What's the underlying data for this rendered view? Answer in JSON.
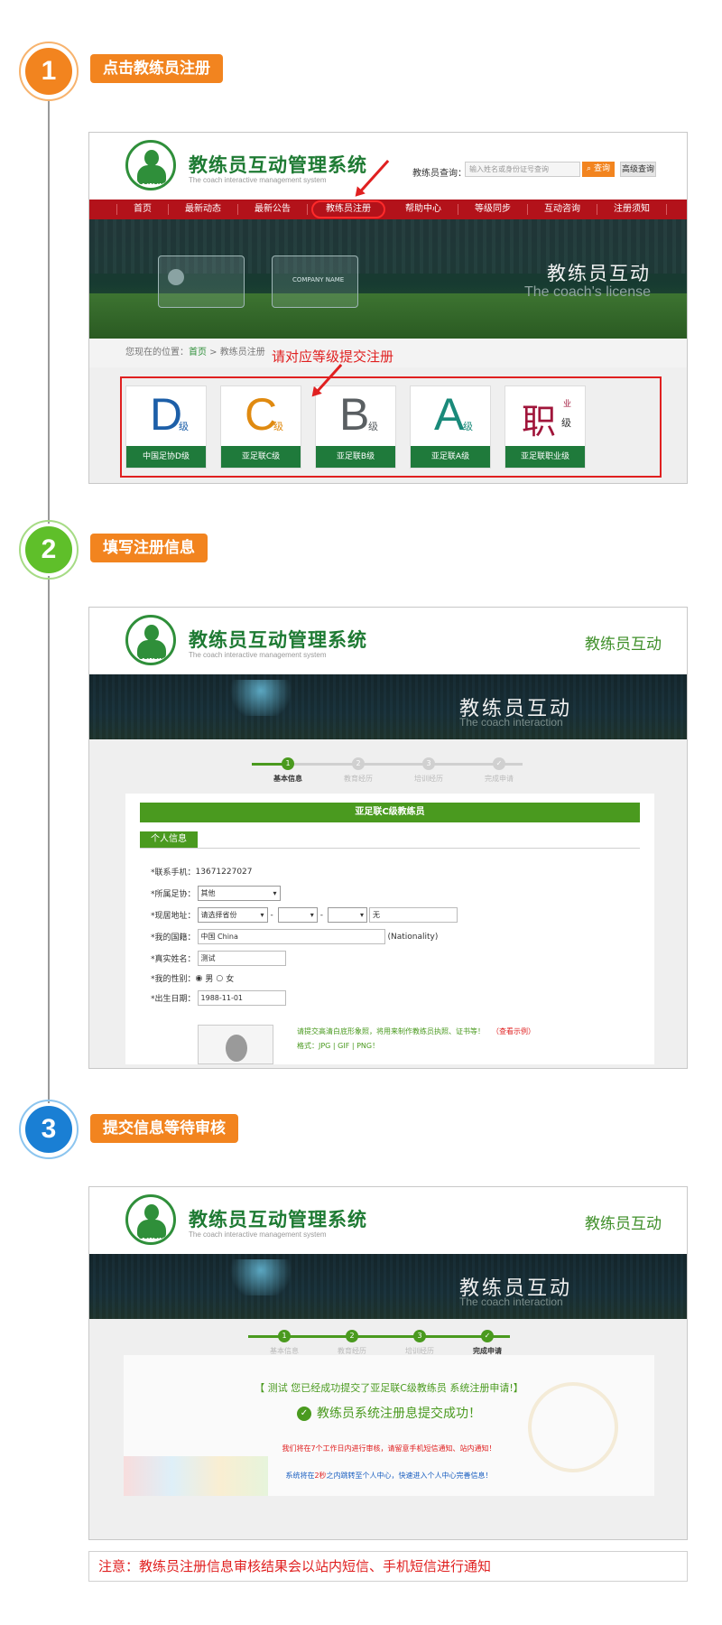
{
  "steps": [
    {
      "number": "1",
      "label": "点击教练员注册",
      "color": "#f2841f"
    },
    {
      "number": "2",
      "label": "填写注册信息",
      "color": "#5fbf2a"
    },
    {
      "number": "3",
      "label": "提交信息等待审核",
      "color": "#1a7fd4"
    }
  ],
  "site": {
    "title": "教练员互动管理系统",
    "subtitle": "The coach interactive management system",
    "logo_text": "COACH",
    "right_brand": "教练员互动"
  },
  "panel1": {
    "search_label": "教练员查询：",
    "search_placeholder": "输入姓名或身份证号查询",
    "search_button": "查询",
    "advanced_button": "高级查询",
    "nav": [
      "首页",
      "最新动态",
      "最新公告",
      "教练员注册",
      "帮助中心",
      "等级同步",
      "互动咨询",
      "注册须知"
    ],
    "card_label": "COMPANY NAME",
    "banner_cn": "教练员互动",
    "banner_en": "The coach's license",
    "breadcrumb_prefix": "您现在的位置：",
    "breadcrumb_home": "首页",
    "breadcrumb_sep": " > ",
    "breadcrumb_current": "教练员注册",
    "red_note": "请对应等级提交注册",
    "levels": [
      {
        "letter": "D",
        "suffix": "级",
        "label": "中国足协D级",
        "color": "#1d5fa8"
      },
      {
        "letter": "C",
        "suffix": "级",
        "label": "亚足联C级",
        "color": "#e08a10"
      },
      {
        "letter": "B",
        "suffix": "级",
        "label": "亚足联B级",
        "color": "#5a5f62"
      },
      {
        "letter": "A",
        "suffix": "级",
        "label": "亚足联A级",
        "color": "#1a8a7a"
      },
      {
        "letter": "职",
        "suffix": "级",
        "sup": "业",
        "label": "亚足联职业级",
        "color": "#a0153a"
      }
    ]
  },
  "panel2": {
    "banner_cn": "教练员互动",
    "banner_en": "The coach interaction",
    "stepper": [
      "基本信息",
      "教育经历",
      "培训经历",
      "完成申请"
    ],
    "form_header": "亚足联C级教练员",
    "tab": "个人信息",
    "fields": {
      "phone_label": "*联系手机：",
      "phone_value": "13671227027",
      "area_label": "*所属足协：",
      "area_value": "其他",
      "addr_label": "*现居地址：",
      "addr_province": "请选择省份",
      "addr_dash": "-",
      "addr_value": "无",
      "nation_label": "*我的国籍：",
      "nation_value": "中国 China",
      "nation_hint": "(Nationality)",
      "name_label": "*真实姓名：",
      "name_value": "测试",
      "gender_label": "*我的性别：",
      "gender_male": "男",
      "gender_female": "女",
      "birth_label": "*出生日期：",
      "birth_value": "1988-11-01"
    },
    "photo_tip": "请提交高清白底形象照，将用来制作教练员执照、证书等！",
    "photo_sample": "（查看示例）",
    "photo_format": "格式：JPG | GIF | PNG！"
  },
  "panel3": {
    "banner_cn": "教练员互动",
    "banner_en": "The coach interaction",
    "stepper": [
      "基本信息",
      "教育经历",
      "培训经历",
      "完成申请"
    ],
    "done_title": "【 测试 您已经成功提交了亚足联C级教练员 系统注册申请!】",
    "done_ok": "教练员系统注册息提交成功！",
    "done_red": "我们将在7个工作日内进行审核，请留意手机短信通知、站内通知！",
    "done_blue_pre": "系统将在",
    "done_blue_time": "2秒",
    "done_blue_post": "之内跳转至个人中心，快速进入个人中心完善信息！"
  },
  "notice": "注意：教练员注册信息审核结果会以站内短信、手机短信进行通知"
}
